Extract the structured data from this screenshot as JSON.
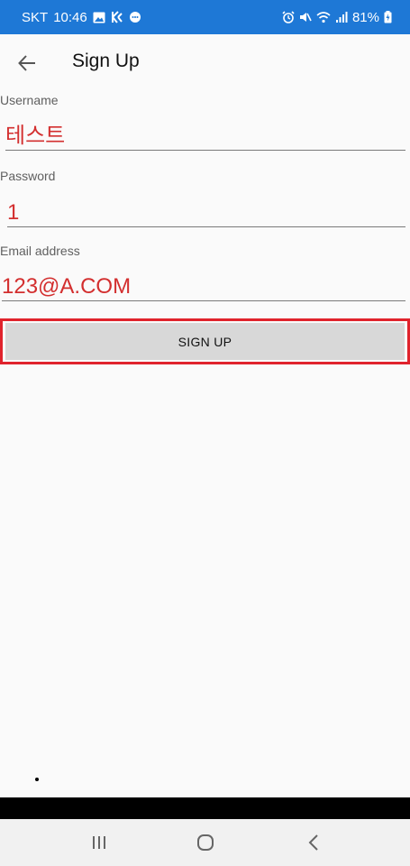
{
  "status_bar": {
    "carrier": "SKT",
    "time": "10:46",
    "battery": "81%",
    "icons_left": [
      "image-icon",
      "k-app-icon",
      "message-icon"
    ],
    "icons_right": [
      "alarm-icon",
      "mute-icon",
      "wifi-icon",
      "signal-icon",
      "battery-charging-icon"
    ]
  },
  "header": {
    "title": "Sign Up",
    "back_icon": "arrow-back-icon"
  },
  "form": {
    "username": {
      "label": "Username",
      "value": "테스트"
    },
    "password": {
      "label": "Password",
      "value": "1"
    },
    "email": {
      "label": "Email address",
      "value": "123@A.COM"
    },
    "submit_label": "SIGN UP"
  },
  "colors": {
    "status_bar": "#1e78d6",
    "input_text": "#d32f2f",
    "highlight_border": "#e0232c",
    "button_bg": "#d8d8d8"
  },
  "nav_bar": {
    "icons": [
      "recent-apps-icon",
      "home-icon",
      "back-nav-icon"
    ]
  }
}
